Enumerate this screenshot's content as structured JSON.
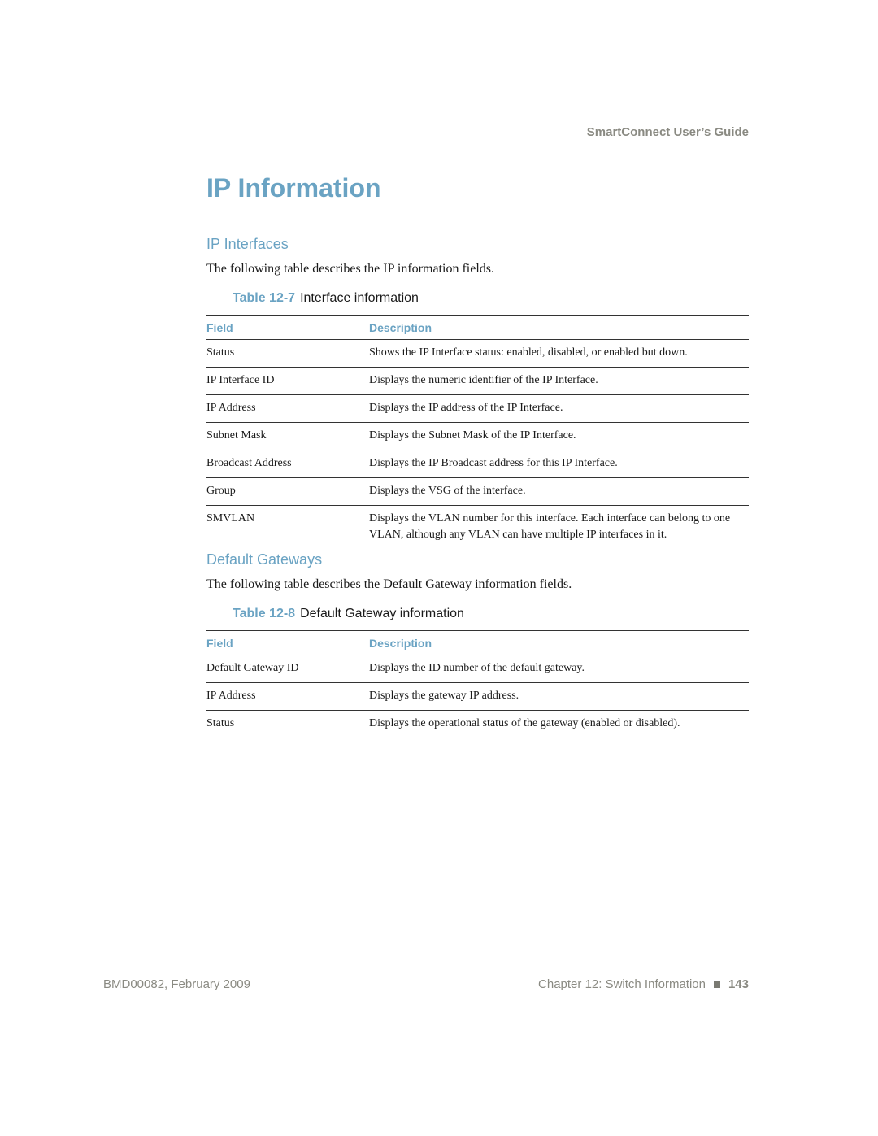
{
  "header": {
    "running_title": "SmartConnect User’s Guide"
  },
  "chapter_title": "IP Information",
  "sections": [
    {
      "heading": "IP Interfaces",
      "intro": "The following table describes the IP information fields.",
      "table": {
        "number": "Table 12-7",
        "caption": "Interface information",
        "columns": [
          "Field",
          "Description"
        ],
        "rows": [
          [
            "Status",
            "Shows the IP Interface status: enabled, disabled, or enabled but down."
          ],
          [
            "IP Interface ID",
            "Displays the numeric identifier of the IP Interface."
          ],
          [
            "IP Address",
            "Displays the IP address of the IP Interface."
          ],
          [
            "Subnet Mask",
            "Displays the Subnet Mask of the IP Interface."
          ],
          [
            "Broadcast Address",
            "Displays the IP Broadcast address for this IP Interface."
          ],
          [
            "Group",
            "Displays the VSG of the interface."
          ],
          [
            "SMVLAN",
            "Displays the VLAN number for this interface. Each interface can belong to one VLAN, although any VLAN can have multiple IP interfaces in it."
          ]
        ]
      }
    },
    {
      "heading": "Default Gateways",
      "intro": "The following table describes the Default Gateway information fields.",
      "table": {
        "number": "Table 12-8",
        "caption": "Default Gateway information",
        "columns": [
          "Field",
          "Description"
        ],
        "rows": [
          [
            "Default Gateway ID",
            "Displays the ID number of the default gateway."
          ],
          [
            "IP Address",
            "Displays the gateway IP address."
          ],
          [
            "Status",
            "Displays the operational status of the gateway (enabled or disabled)."
          ]
        ]
      }
    }
  ],
  "footer": {
    "doc_id": "BMD00082, February 2009",
    "chapter": "Chapter 12: Switch Information",
    "bullet_icon": "square-bullet",
    "page_number": "143"
  }
}
